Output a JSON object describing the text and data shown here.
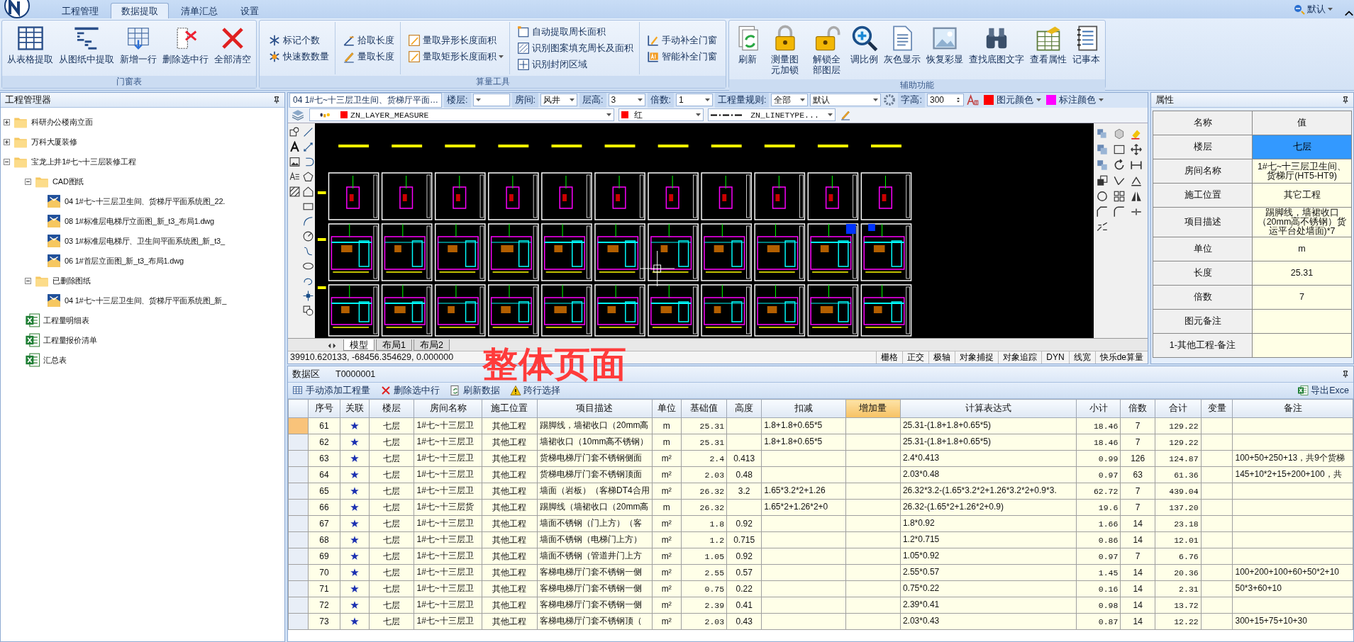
{
  "menu_tabs": [
    {
      "label": "工程管理",
      "selected": false
    },
    {
      "label": "数据提取",
      "selected": true
    },
    {
      "label": "清单汇总",
      "selected": false
    },
    {
      "label": "设置",
      "selected": false
    }
  ],
  "profile": "默认",
  "ribbon": {
    "groups": [
      {
        "title": "门窗表",
        "kind": "large",
        "buttons": [
          {
            "label": "从表格提取"
          },
          {
            "label": "从图纸中提取"
          },
          {
            "label": "新增一行"
          },
          {
            "label": "删除选中行"
          },
          {
            "label": "全部清空"
          }
        ]
      },
      {
        "title": "算量工具",
        "kind": "small",
        "columns": [
          [
            {
              "label": "标记个数",
              "has_menu": false
            },
            {
              "label": "快速数数量",
              "has_menu": false
            }
          ],
          [
            {
              "label": "拾取长度",
              "has_menu": false
            },
            {
              "label": "量取长度",
              "has_menu": false
            }
          ],
          [
            {
              "label": "量取异形长度面积",
              "has_menu": false
            },
            {
              "label": "量取矩形长度面积",
              "has_menu": true
            }
          ],
          [
            {
              "label": "自动提取周长面积",
              "has_menu": false
            },
            {
              "label": "识别图案填充周长及面积",
              "has_menu": false
            },
            {
              "label": "识别封闭区域",
              "has_menu": false
            }
          ],
          [
            {
              "label": "手动补全门窗",
              "has_menu": false
            },
            {
              "label": "智能补全门窗",
              "has_menu": false
            }
          ]
        ]
      },
      {
        "title": "辅助功能",
        "kind": "large",
        "buttons": [
          {
            "label": "刷新"
          },
          {
            "label": "测量图元加锁"
          },
          {
            "label": "解锁全部图层"
          },
          {
            "label": "调比例"
          },
          {
            "label": "灰色显示"
          },
          {
            "label": "恢复彩显"
          },
          {
            "label": "查找底图文字"
          },
          {
            "label": "查看属性"
          },
          {
            "label": "记事本"
          }
        ]
      }
    ]
  },
  "project_manager": {
    "title": "工程管理器",
    "tree": [
      {
        "label": "科研办公楼南立面",
        "kind": "folder",
        "expanded": false
      },
      {
        "label": "万科大厦装修",
        "kind": "folder",
        "expanded": false
      },
      {
        "label": "宝龙上井1#七~十三层装修工程",
        "kind": "folder",
        "expanded": true,
        "children": [
          {
            "label": "CAD图纸",
            "kind": "folder",
            "expanded": true,
            "children": [
              {
                "label": "04 1#七~十三层卫生间、货梯厅平面系统图_22.",
                "kind": "dwg"
              },
              {
                "label": "08 1#标准层电梯厅立面图_新_t3_布局1.dwg",
                "kind": "dwg"
              },
              {
                "label": "03 1#标准层电梯厅、卫生间平面系统图_新_t3_",
                "kind": "dwg"
              },
              {
                "label": "06 1#首层立面图_新_t3_布局1.dwg",
                "kind": "dwg"
              }
            ]
          },
          {
            "label": "已删除图纸",
            "kind": "folder",
            "expanded": true,
            "children": [
              {
                "label": "04 1#七~十三层卫生间、货梯厅平面系统图_新_",
                "kind": "dwg"
              }
            ]
          },
          {
            "label": "工程量明细表",
            "kind": "excel"
          },
          {
            "label": "工程量报价清单",
            "kind": "excel"
          },
          {
            "label": "汇总表",
            "kind": "excel"
          }
        ]
      }
    ]
  },
  "cad_toolbar": {
    "drawing_title": "04 1#七~十三层卫生间、货梯厅平面…",
    "fields": [
      {
        "kind": "combo",
        "label": "楼层:"
      },
      {
        "kind": "combo",
        "label": "房间:",
        "value": "风井"
      },
      {
        "kind": "combo",
        "label": "层高:",
        "value": "3"
      },
      {
        "kind": "combo",
        "label": "倍数:",
        "value": "1"
      },
      {
        "kind": "combo",
        "label": "工程量规则:",
        "value": "全部"
      },
      {
        "kind": "combo",
        "value": "默认"
      },
      {
        "kind": "spin",
        "label": "字高:",
        "value": "300"
      },
      {
        "kind": "color",
        "label": "图元颜色",
        "color": "#ff0000"
      },
      {
        "kind": "color",
        "label": "标注颜色",
        "color": "#ff00ff"
      }
    ],
    "layer": {
      "name": "ZN_LAYER_MEASURE",
      "color": "#ff0000"
    },
    "layer_color": {
      "name": "红",
      "color": "#ff0000"
    },
    "linetype": "ZN_LINETYPE..."
  },
  "layout_tabs": [
    {
      "label": "模型",
      "selected": true
    },
    {
      "label": "布局1",
      "selected": false
    },
    {
      "label": "布局2",
      "selected": false
    }
  ],
  "coordinates": "39910.620133, -68456.354629, 0.000000",
  "status_toggles": [
    "栅格",
    "正交",
    "极轴",
    "对象捕捉",
    "对象追踪",
    "DYN",
    "线宽",
    "快乐de算量"
  ],
  "overlay_caption": "整体页面",
  "properties": {
    "title": "属性",
    "header": [
      "名称",
      "值"
    ],
    "rows": [
      {
        "name": "楼层",
        "value": "七层",
        "selected": true
      },
      {
        "name": "房间名称",
        "value": "1#七~十三层卫生间、货梯厅(HT5-HT9)",
        "selected": false
      },
      {
        "name": "施工位置",
        "value": "其它工程",
        "selected": false
      },
      {
        "name": "项目描述",
        "value": "踢脚线，墙裙收口（20mm高不锈钢）货运平台处墙面)*7",
        "selected": false
      },
      {
        "name": "单位",
        "value": "m",
        "selected": false
      },
      {
        "name": "长度",
        "value": "25.31",
        "selected": false
      },
      {
        "name": "倍数",
        "value": "7",
        "selected": false
      },
      {
        "name": "图元备注",
        "selected": false
      },
      {
        "name": "1-其他工程-备注",
        "selected": false
      }
    ]
  },
  "data_area": {
    "title": "数据区",
    "code": "T0000001",
    "toolbar": [
      {
        "label": "手动添加工程量"
      },
      {
        "label": "删除选中行"
      },
      {
        "label": "刷新数据"
      },
      {
        "label": "跨行选择"
      }
    ],
    "export": "导出Exce",
    "columns": [
      {
        "label": "序号",
        "kind": "center",
        "selected": false
      },
      {
        "label": "关联",
        "kind": "star",
        "selected": false
      },
      {
        "label": "楼层",
        "kind": "center",
        "selected": false
      },
      {
        "label": "房间名称",
        "kind": "text",
        "selected": false
      },
      {
        "label": "施工位置",
        "kind": "center",
        "selected": false
      },
      {
        "label": "项目描述",
        "kind": "text",
        "selected": false
      },
      {
        "label": "单位",
        "kind": "center",
        "selected": false
      },
      {
        "label": "基础值",
        "kind": "number",
        "selected": false
      },
      {
        "label": "高度",
        "kind": "center",
        "selected": false
      },
      {
        "label": "扣减",
        "kind": "text",
        "selected": false
      },
      {
        "label": "增加量",
        "kind": "text",
        "selected": true
      },
      {
        "label": "计算表达式",
        "kind": "text",
        "selected": false
      },
      {
        "label": "小计",
        "kind": "number",
        "selected": false
      },
      {
        "label": "倍数",
        "kind": "center",
        "selected": false
      },
      {
        "label": "合计",
        "kind": "number",
        "selected": false
      },
      {
        "label": "变量",
        "kind": "center",
        "selected": false
      },
      {
        "label": "备注",
        "kind": "text",
        "selected": false
      }
    ],
    "rows": [
      {
        "selected": true,
        "cells": [
          "61",
          "★",
          "七层",
          "1#七~十三层卫",
          "其他工程",
          "踢脚线，墙裙收口（20mm高",
          "m",
          "25.31",
          "",
          "1.8+1.8+0.65*5",
          "",
          "25.31-(1.8+1.8+0.65*5)",
          "18.46",
          "7",
          "129.22",
          "",
          ""
        ]
      },
      {
        "selected": false,
        "cells": [
          "62",
          "★",
          "七层",
          "1#七~十三层卫",
          "其他工程",
          "墙裙收口（10mm高不锈钢）",
          "m",
          "25.31",
          "",
          "1.8+1.8+0.65*5",
          "",
          "25.31-(1.8+1.8+0.65*5)",
          "18.46",
          "7",
          "129.22",
          "",
          ""
        ]
      },
      {
        "selected": false,
        "cells": [
          "63",
          "★",
          "七层",
          "1#七~十三层卫",
          "其他工程",
          "货梯电梯厅门套不锈钢侧面",
          "m²",
          "2.4",
          "0.413",
          "",
          "",
          "2.4*0.413",
          "0.99",
          "126",
          "124.87",
          "",
          "100+50+250+13，共9个货梯"
        ]
      },
      {
        "selected": false,
        "cells": [
          "64",
          "★",
          "七层",
          "1#七~十三层卫",
          "其他工程",
          "货梯电梯厅门套不锈钢顶面",
          "m²",
          "2.03",
          "0.48",
          "",
          "",
          "2.03*0.48",
          "0.97",
          "63",
          "61.36",
          "",
          "145+10*2+15+200+100，共"
        ]
      },
      {
        "selected": false,
        "cells": [
          "65",
          "★",
          "七层",
          "1#七~十三层卫",
          "其他工程",
          "墙面（岩板）（客梯DT4合用",
          "m²",
          "26.32",
          "3.2",
          "1.65*3.2*2+1.26",
          "",
          "26.32*3.2-(1.65*3.2*2+1.26*3.2*2+0.9*3.",
          "62.72",
          "7",
          "439.04",
          "",
          ""
        ]
      },
      {
        "selected": false,
        "cells": [
          "66",
          "★",
          "七层",
          "1#七~十三层货",
          "其他工程",
          "踢脚线（墙裙收口（20mm高",
          "m",
          "26.32",
          "",
          "1.65*2+1.26*2+0",
          "",
          "26.32-(1.65*2+1.26*2+0.9)",
          "19.6",
          "7",
          "137.20",
          "",
          ""
        ]
      },
      {
        "selected": false,
        "cells": [
          "67",
          "★",
          "七层",
          "1#七~十三层卫",
          "其他工程",
          "墙面不锈钢（门上方）（客",
          "m²",
          "1.8",
          "0.92",
          "",
          "",
          "1.8*0.92",
          "1.66",
          "14",
          "23.18",
          "",
          ""
        ]
      },
      {
        "selected": false,
        "cells": [
          "68",
          "★",
          "七层",
          "1#七~十三层卫",
          "其他工程",
          "墙面不锈钢（电梯门上方）",
          "m²",
          "1.2",
          "0.715",
          "",
          "",
          "1.2*0.715",
          "0.86",
          "14",
          "12.01",
          "",
          ""
        ]
      },
      {
        "selected": false,
        "cells": [
          "69",
          "★",
          "七层",
          "1#七~十三层卫",
          "其他工程",
          "墙面不锈钢（管道井门上方",
          "m²",
          "1.05",
          "0.92",
          "",
          "",
          "1.05*0.92",
          "0.97",
          "7",
          "6.76",
          "",
          ""
        ]
      },
      {
        "selected": false,
        "cells": [
          "70",
          "★",
          "七层",
          "1#七~十三层卫",
          "其他工程",
          "客梯电梯厅门套不锈钢一侧",
          "m²",
          "2.55",
          "0.57",
          "",
          "",
          "2.55*0.57",
          "1.45",
          "14",
          "20.36",
          "",
          "100+200+100+60+50*2+10"
        ]
      },
      {
        "selected": false,
        "cells": [
          "71",
          "★",
          "七层",
          "1#七~十三层卫",
          "其他工程",
          "客梯电梯厅门套不锈钢一侧",
          "m²",
          "0.75",
          "0.22",
          "",
          "",
          "0.75*0.22",
          "0.16",
          "14",
          "2.31",
          "",
          "50*3+60+10"
        ]
      },
      {
        "selected": false,
        "cells": [
          "72",
          "★",
          "七层",
          "1#七~十三层卫",
          "其他工程",
          "客梯电梯厅门套不锈钢一侧",
          "m²",
          "2.39",
          "0.41",
          "",
          "",
          "2.39*0.41",
          "0.98",
          "14",
          "13.72",
          "",
          ""
        ]
      },
      {
        "selected": false,
        "cells": [
          "73",
          "★",
          "七层",
          "1#七~十三层卫",
          "其他工程",
          "客梯电梯厅门套不锈钢顶（",
          "m²",
          "2.03",
          "0.43",
          "",
          "",
          "2.03*0.43",
          "0.87",
          "14",
          "12.22",
          "",
          "300+15+75+10+30"
        ]
      }
    ]
  }
}
